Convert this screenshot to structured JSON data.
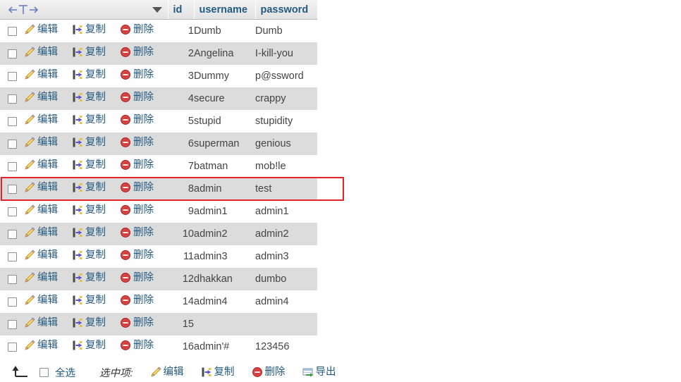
{
  "table": {
    "tools_header_icon": "column-direction-marker",
    "sort_icon": "chevron-down-icon",
    "columns": [
      {
        "key": "id",
        "label": "id"
      },
      {
        "key": "username",
        "label": "username"
      },
      {
        "key": "password",
        "label": "password"
      }
    ],
    "row_actions": {
      "edit": {
        "label": "编辑",
        "icon": "pencil-icon"
      },
      "copy": {
        "label": "复制",
        "icon": "copy-icon"
      },
      "delete": {
        "label": "删除",
        "icon": "delete-circle-icon"
      }
    },
    "rows": [
      {
        "id": "1",
        "username": "Dumb",
        "password": "Dumb"
      },
      {
        "id": "2",
        "username": "Angelina",
        "password": "I-kill-you"
      },
      {
        "id": "3",
        "username": "Dummy",
        "password": "p@ssword"
      },
      {
        "id": "4",
        "username": "secure",
        "password": "crappy"
      },
      {
        "id": "5",
        "username": "stupid",
        "password": "stupidity"
      },
      {
        "id": "6",
        "username": "superman",
        "password": "genious"
      },
      {
        "id": "7",
        "username": "batman",
        "password": "mob!le"
      },
      {
        "id": "8",
        "username": "admin",
        "password": "test"
      },
      {
        "id": "9",
        "username": "admin1",
        "password": "admin1"
      },
      {
        "id": "10",
        "username": "admin2",
        "password": "admin2"
      },
      {
        "id": "11",
        "username": "admin3",
        "password": "admin3"
      },
      {
        "id": "12",
        "username": "dhakkan",
        "password": "dumbo"
      },
      {
        "id": "14",
        "username": "admin4",
        "password": "admin4"
      },
      {
        "id": "15",
        "username": "",
        "password": ""
      },
      {
        "id": "16",
        "username": "admin'#",
        "password": "123456"
      }
    ],
    "highlighted_row_id": "8"
  },
  "bottom_bar": {
    "check_all_arrow_icon": "arrow-up-from-line-icon",
    "select_all_label": "全选",
    "with_selected_label": "选中项:",
    "actions": [
      {
        "key": "edit",
        "label": "编辑",
        "icon": "pencil-icon"
      },
      {
        "key": "copy",
        "label": "复制",
        "icon": "copy-icon"
      },
      {
        "key": "delete",
        "label": "删除",
        "icon": "delete-circle-icon"
      },
      {
        "key": "export",
        "label": "导出",
        "icon": "export-table-icon"
      }
    ]
  },
  "colors": {
    "header_text": "#235a81",
    "link": "#235a81",
    "row_even_bg": "#dcdcdc",
    "row_odd_bg": "#ffffff",
    "header_bg": "#e5e5e5",
    "highlight_border": "#e8222a",
    "body_text": "#444444"
  }
}
